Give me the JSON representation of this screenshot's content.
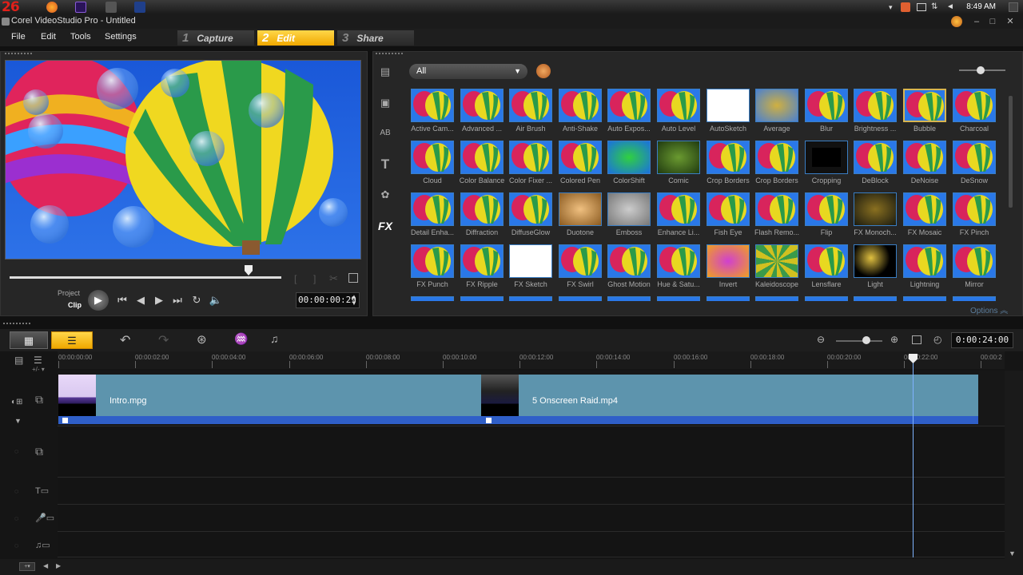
{
  "taskbar": {
    "badge": "26",
    "clock": "8:49 AM"
  },
  "window": {
    "title": "Corel VideoStudio Pro - Untitled"
  },
  "menu": [
    "File",
    "Edit",
    "Tools",
    "Settings"
  ],
  "steps": [
    {
      "num": "1",
      "label": "Capture"
    },
    {
      "num": "2",
      "label": "Edit"
    },
    {
      "num": "3",
      "label": "Share"
    }
  ],
  "preview": {
    "mode_project": "Project",
    "mode_clip": "Clip",
    "timecode": "00:00:00:29",
    "scrub_position": 0.88
  },
  "library": {
    "filter": "All",
    "side_fx": "FX",
    "options_label": "Options",
    "effects": [
      "Active Cam...",
      "Advanced ...",
      "Air Brush",
      "Anti-Shake",
      "Auto Expos...",
      "Auto Level",
      "AutoSketch",
      "Average",
      "Blur",
      "Brightness ...",
      "Bubble",
      "Charcoal",
      "Cloud",
      "Color Balance",
      "Color Fixer ...",
      "Colored Pen",
      "ColorShift",
      "Comic",
      "Crop Borders",
      "Crop Borders",
      "Cropping",
      "DeBlock",
      "DeNoise",
      "DeSnow",
      "Detail Enha...",
      "Diffraction",
      "DiffuseGlow",
      "Duotone",
      "Emboss",
      "Enhance Li...",
      "Fish Eye",
      "Flash Remo...",
      "Flip",
      "FX Monoch...",
      "FX Mosaic",
      "FX Pinch",
      "FX Punch",
      "FX Ripple",
      "FX Sketch",
      "FX Swirl",
      "Ghost Motion",
      "Hue & Satu...",
      "Invert",
      "Kaleidoscope",
      "Lensflare",
      "Light",
      "Lightning",
      "Mirror"
    ]
  },
  "timeline": {
    "timecode": "0:00:24:00",
    "ruler": [
      "00:00:00:00",
      "00:00:02:00",
      "00:00:04:00",
      "00:00:06:00",
      "00:00:08:00",
      "00:00:10:00",
      "00:00:12:00",
      "00:00:14:00",
      "00:00:16:00",
      "00:00:18:00",
      "00:00:20:00",
      "00:00:22:00",
      "00:00:2"
    ],
    "clips": [
      {
        "name": "Intro.mpg"
      },
      {
        "name": "5 Onscreen Raid.mp4"
      }
    ]
  },
  "colors": {
    "accent": "#f5b800",
    "clip": "#5d94ad",
    "clip_bar": "#2f5fc8"
  }
}
